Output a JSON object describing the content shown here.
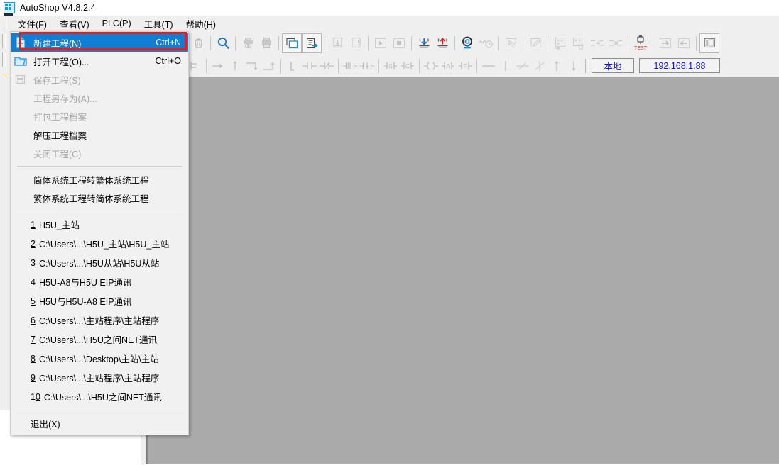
{
  "window": {
    "title": "AutoShop V4.8.2.4",
    "icon": "autoshop-logo-icon"
  },
  "menubar": {
    "items": [
      {
        "label": "文件(F)",
        "name": "menu-file",
        "open": true
      },
      {
        "label": "查看(V)",
        "name": "menu-view",
        "open": false
      },
      {
        "label": "PLC(P)",
        "name": "menu-plc",
        "open": false
      },
      {
        "label": "工具(T)",
        "name": "menu-tools",
        "open": false
      },
      {
        "label": "帮助(H)",
        "name": "menu-help",
        "open": false
      }
    ]
  },
  "file_menu": {
    "items": [
      {
        "label": "新建工程(N)",
        "accel": "Ctrl+N",
        "state": "selected",
        "icon": "new-project-icon"
      },
      {
        "label": "打开工程(O)...",
        "accel": "Ctrl+O",
        "state": "normal",
        "icon": "open-folder-icon"
      },
      {
        "label": "保存工程(S)",
        "accel": "",
        "state": "disabled",
        "icon": "save-icon"
      },
      {
        "label": "工程另存为(A)...",
        "accel": "",
        "state": "disabled",
        "icon": ""
      },
      {
        "label": "打包工程档案",
        "accel": "",
        "state": "disabled",
        "icon": ""
      },
      {
        "label": "解压工程档案",
        "accel": "",
        "state": "normal",
        "icon": ""
      },
      {
        "label": "关闭工程(C)",
        "accel": "",
        "state": "disabled",
        "icon": ""
      }
    ],
    "convert_items": [
      {
        "label": "简体系统工程转繁体系统工程"
      },
      {
        "label": "繁体系统工程转简体系统工程"
      }
    ],
    "recent_files": [
      {
        "index": "1",
        "label": "H5U_主站"
      },
      {
        "index": "2",
        "label": "C:\\Users\\...\\H5U_主站\\H5U_主站"
      },
      {
        "index": "3",
        "label": "C:\\Users\\...\\H5U从站\\H5U从站"
      },
      {
        "index": "4",
        "label": "H5U-A8与H5U EIP通讯"
      },
      {
        "index": "5",
        "label": "H5U与H5U-A8 EIP通讯"
      },
      {
        "index": "6",
        "label": "C:\\Users\\...\\主站程序\\主站程序"
      },
      {
        "index": "7",
        "label": "C:\\Users\\...\\H5U之间NET通讯"
      },
      {
        "index": "8",
        "label": "C:\\Users\\...\\Desktop\\主站\\主站"
      },
      {
        "index": "9",
        "label": "C:\\Users\\...\\主站程序\\主站程序"
      },
      {
        "index": "10",
        "label": "C:\\Users\\...\\H5U之间NET通讯"
      }
    ],
    "exit": {
      "label": "退出(X)"
    }
  },
  "toolbar_main": {
    "buttons": [
      {
        "name": "delete-icon",
        "state": "disabled"
      },
      {
        "name": "search-icon",
        "state": "enabled"
      },
      {
        "name": "print-preview-icon",
        "state": "disabled"
      },
      {
        "name": "print-icon",
        "state": "disabled"
      },
      {
        "name": "copy-window-icon",
        "state": "enabled"
      },
      {
        "name": "export-window-icon",
        "state": "enabled"
      },
      {
        "name": "import-data-icon",
        "state": "disabled"
      },
      {
        "name": "export-data-icon",
        "state": "disabled"
      },
      {
        "name": "run-icon",
        "state": "disabled"
      },
      {
        "name": "stop-icon",
        "state": "disabled"
      },
      {
        "name": "download-icon",
        "state": "enabled"
      },
      {
        "name": "upload-icon",
        "state": "enabled"
      },
      {
        "name": "monitor-icon",
        "state": "enabled"
      },
      {
        "name": "trace-icon",
        "state": "disabled"
      },
      {
        "name": "simulate-icon",
        "state": "disabled"
      },
      {
        "name": "edit-icon",
        "state": "disabled"
      },
      {
        "name": "compile-icon",
        "state": "disabled"
      },
      {
        "name": "clean-compile-icon",
        "state": "disabled"
      },
      {
        "name": "insert-row-icon",
        "state": "disabled"
      },
      {
        "name": "delete-row-icon",
        "state": "disabled"
      },
      {
        "name": "usb-test-icon",
        "state": "enabled",
        "caption": "TEST"
      },
      {
        "name": "login-icon",
        "state": "disabled"
      },
      {
        "name": "logout-icon",
        "state": "disabled"
      },
      {
        "name": "panel-toggle-icon",
        "state": "enabled"
      }
    ]
  },
  "toolbar_ladder": {
    "buttons": [
      {
        "name": "wire-horizontal-icon"
      },
      {
        "name": "wire-up-icon"
      },
      {
        "name": "wire-corner-down-icon"
      },
      {
        "name": "wire-corner-up-icon"
      },
      {
        "name": "rung-end-icon"
      },
      {
        "name": "contact-no-icon"
      },
      {
        "name": "contact-nc-icon"
      },
      {
        "name": "contact-rising-icon"
      },
      {
        "name": "contact-falling-icon"
      },
      {
        "name": "contact-set-icon"
      },
      {
        "name": "contact-reset-icon"
      },
      {
        "name": "coil-icon"
      },
      {
        "name": "coil-a-icon"
      },
      {
        "name": "coil-f-icon"
      },
      {
        "name": "line-horizontal-icon"
      },
      {
        "name": "line-vertical-icon"
      },
      {
        "name": "line-delete-diagonal-icon"
      },
      {
        "name": "line-delete-cross-icon"
      },
      {
        "name": "arrow-up-icon"
      },
      {
        "name": "arrow-down-icon"
      }
    ],
    "local_button": {
      "label": "本地"
    },
    "ip_field": {
      "value": "192.168.1.88"
    }
  },
  "colors": {
    "accent_selection": "#0e7fd4",
    "annotation": "#ef1b1b",
    "workspace": "#aaaaaa",
    "chrome": "#efefef",
    "link_blue": "#1010cd"
  }
}
